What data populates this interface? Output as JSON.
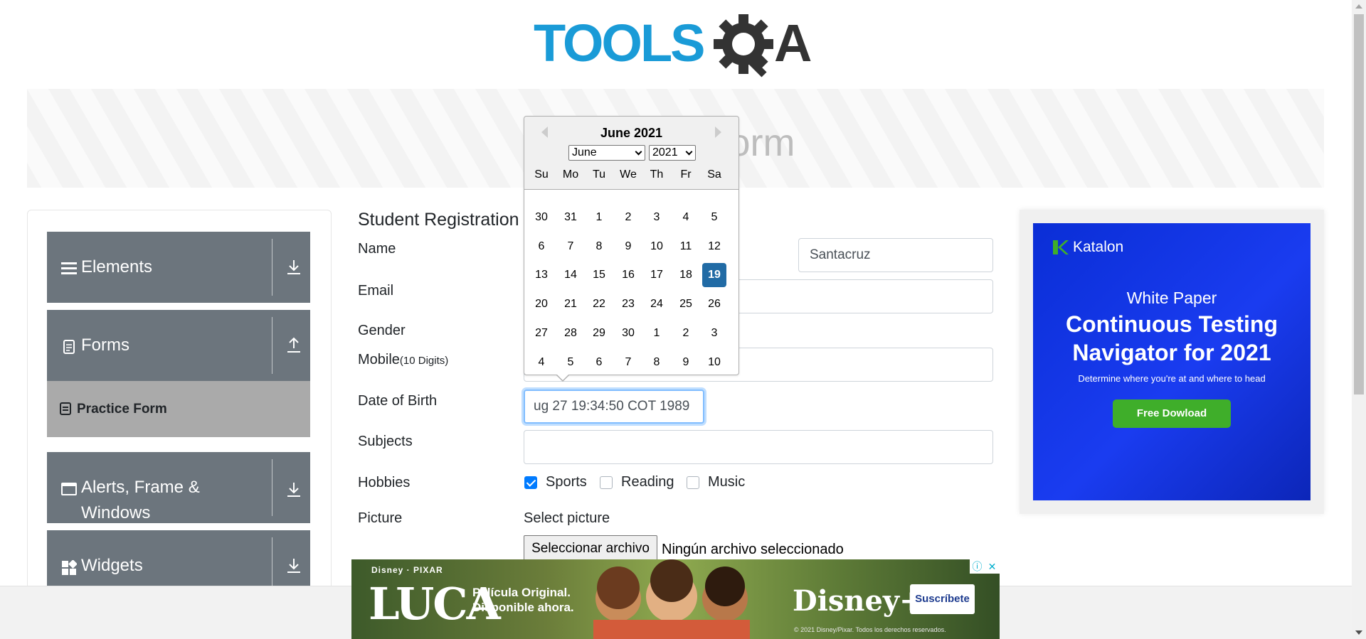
{
  "header": {
    "logo_text_1": "TOOLS",
    "logo_text_2": "A"
  },
  "banner": {
    "title": "Practice Form"
  },
  "sidebar": {
    "groups": [
      {
        "label": "Elements",
        "icon": "hamburger-icon",
        "arrow": "download-icon"
      },
      {
        "label": "Forms",
        "icon": "document-icon",
        "arrow": "upload-icon"
      },
      {
        "label": "Alerts, Frame &",
        "label2": "Windows",
        "icon": "window-icon",
        "arrow": "download-icon"
      },
      {
        "label": "Widgets",
        "icon": "widgets-icon",
        "arrow": "download-icon"
      }
    ],
    "active_item": {
      "label": "Practice Form",
      "icon": "form-icon"
    }
  },
  "form": {
    "title": "Student Registration",
    "labels": {
      "name": "Name",
      "email": "Email",
      "gender": "Gender",
      "mobile": "Mobile",
      "mobile_hint": "(10 Digits)",
      "dob": "Date of Birth",
      "subjects": "Subjects",
      "hobbies": "Hobbies",
      "picture": "Picture"
    },
    "last_name_value": "Santacruz",
    "dob_value": "ug 27 19:34:50 COT 1989",
    "hobbies": [
      {
        "label": "Sports",
        "checked": true
      },
      {
        "label": "Reading",
        "checked": false
      },
      {
        "label": "Music",
        "checked": false
      }
    ],
    "select_picture": "Select picture",
    "file_button": "Seleccionar archivo",
    "file_status": "Ningún archivo seleccionado"
  },
  "datepicker": {
    "header": "June 2021",
    "month_select": "June",
    "year_select": "2021",
    "weekdays": [
      "Su",
      "Mo",
      "Tu",
      "We",
      "Th",
      "Fr",
      "Sa"
    ],
    "weeks": [
      [
        "30",
        "31",
        "1",
        "2",
        "3",
        "4",
        "5"
      ],
      [
        "6",
        "7",
        "8",
        "9",
        "10",
        "11",
        "12"
      ],
      [
        "13",
        "14",
        "15",
        "16",
        "17",
        "18",
        "19"
      ],
      [
        "20",
        "21",
        "22",
        "23",
        "24",
        "25",
        "26"
      ],
      [
        "27",
        "28",
        "29",
        "30",
        "1",
        "2",
        "3"
      ],
      [
        "4",
        "5",
        "6",
        "7",
        "8",
        "9",
        "10"
      ]
    ],
    "selected_day": "19",
    "selected_color": "#216ba5"
  },
  "ad_right": {
    "brand": "Katalon",
    "line1": "White Paper",
    "line2": "Continuous Testing",
    "line3": "Navigator for 2021",
    "sub": "Determine where you're at and where to head",
    "button": "Free Dowload"
  },
  "ad_bottom": {
    "studio": "Disney · PIXAR",
    "title": "LUCA",
    "line1": "Película Original.",
    "line2": "Disponible ahora.",
    "brand": "Disney+",
    "button": "Suscríbete",
    "copyright": "© 2021 Disney/Pixar. Todos los derechos reservados."
  },
  "colors": {
    "accent": "#007bff",
    "sidebar_group": "#6c757d",
    "active_item": "#aaaaaa",
    "logo_blue": "#1a9bd7",
    "logo_dark": "#333333"
  }
}
